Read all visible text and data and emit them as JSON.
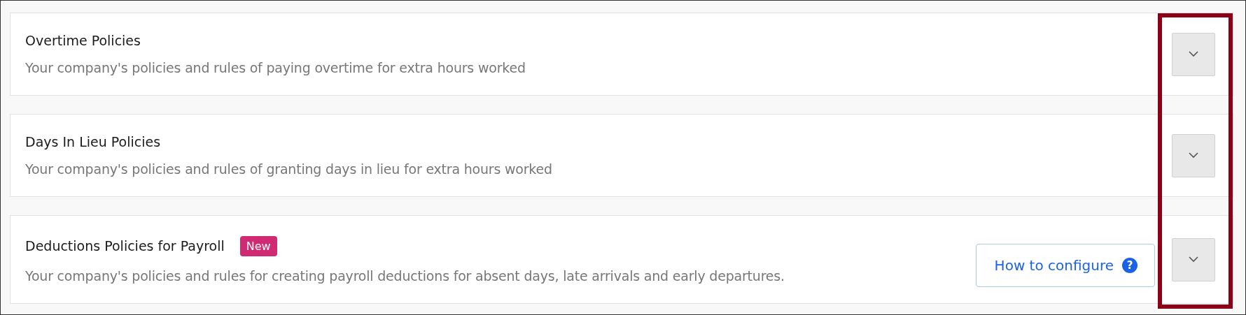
{
  "policies": [
    {
      "title": "Overtime Policies",
      "description": "Your company's policies and rules of paying overtime for extra hours worked",
      "expanded": false
    },
    {
      "title": "Days In Lieu Policies",
      "description": "Your company's policies and rules of granting days in lieu for extra hours worked",
      "expanded": false
    },
    {
      "title": "Deductions Policies for Payroll",
      "badge": "New",
      "description": "Your company's policies and rules for creating payroll deductions for absent days, late arrivals and early departures.",
      "help_button": {
        "label": "How to configure",
        "icon": "?"
      },
      "expanded": false
    }
  ]
}
